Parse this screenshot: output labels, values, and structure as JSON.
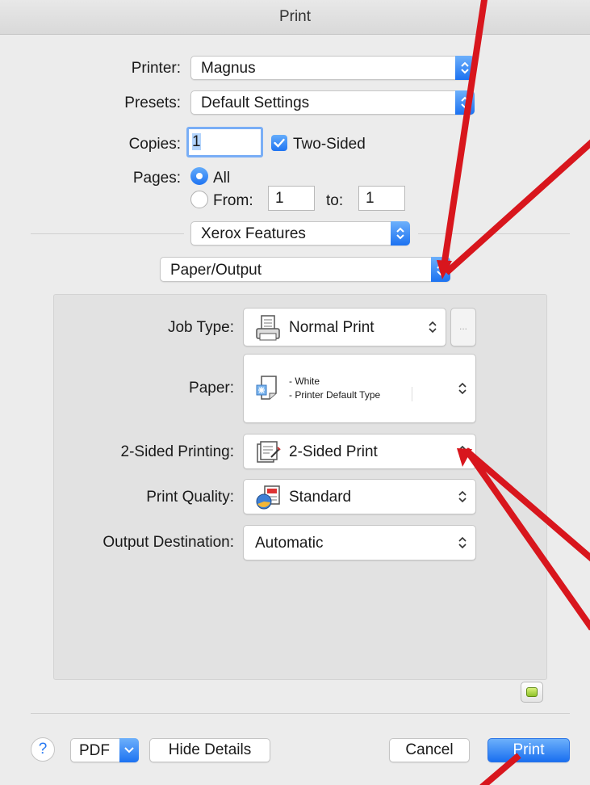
{
  "window": {
    "title": "Print"
  },
  "printer": {
    "label": "Printer:",
    "value": "Magnus"
  },
  "presets": {
    "label": "Presets:",
    "value": "Default Settings"
  },
  "copies": {
    "label": "Copies:",
    "value": "1",
    "two_sided_label": "Two-Sided",
    "two_sided_checked": true
  },
  "pages": {
    "label": "Pages:",
    "all_label": "All",
    "from_label": "From:",
    "from_value": "1",
    "to_label": "to:",
    "to_value": "1",
    "selected": "All"
  },
  "feature_set": {
    "value": "Xerox Features"
  },
  "feature_panel": {
    "value": "Paper/Output"
  },
  "panel": {
    "job_type": {
      "label": "Job Type:",
      "value": "Normal Print",
      "more_label": "..."
    },
    "paper": {
      "label": "Paper:",
      "line1": "- White",
      "line2": "- Printer Default Type"
    },
    "two_sided_printing": {
      "label": "2-Sided Printing:",
      "value": "2-Sided Print"
    },
    "print_quality": {
      "label": "Print Quality:",
      "value": "Standard"
    },
    "output_destination": {
      "label": "Output Destination:",
      "value": "Automatic"
    }
  },
  "footer": {
    "help": "?",
    "pdf": "PDF",
    "hide_details": "Hide Details",
    "cancel": "Cancel",
    "print": "Print"
  },
  "colors": {
    "accent": "#1f74f2",
    "annotation": "#d8161d"
  }
}
